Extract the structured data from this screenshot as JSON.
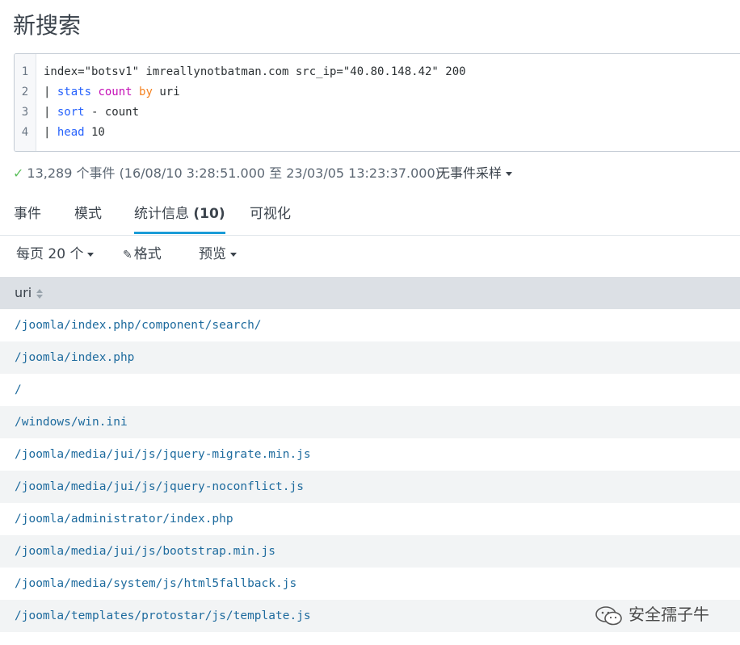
{
  "page_title": "新搜索",
  "query": {
    "line_numbers": [
      "1",
      "2",
      "3",
      "4"
    ],
    "line1": "index=\"botsv1\" imreallynotbatman.com src_ip=\"40.80.148.42\" 200",
    "line2": {
      "pipe": "| ",
      "cmd": "stats",
      "func": "count",
      "by": "by",
      "field": "uri"
    },
    "line3": {
      "pipe": "| ",
      "cmd": "sort",
      "rest": " - count"
    },
    "line4": {
      "pipe": "| ",
      "cmd": "head",
      "rest": " 10"
    }
  },
  "status": {
    "check_icon": "checkmark-icon",
    "text": "13,289 个事件 (16/08/10 3:28:51.000 至 23/03/05 13:23:37.000)",
    "sampling": "无事件采样"
  },
  "tabs": [
    {
      "label": "事件"
    },
    {
      "label": "模式"
    },
    {
      "label": "统计信息",
      "count": "(10)"
    },
    {
      "label": "可视化"
    }
  ],
  "toolbar": {
    "per_page": "每页 20 个",
    "format": "格式",
    "preview": "预览"
  },
  "table": {
    "column": "uri",
    "rows": [
      "/joomla/index.php/component/search/",
      "/joomla/index.php",
      "/",
      "/windows/win.ini",
      "/joomla/media/jui/js/jquery-migrate.min.js",
      "/joomla/media/jui/js/jquery-noconflict.js",
      "/joomla/administrator/index.php",
      "/joomla/media/jui/js/bootstrap.min.js",
      "/joomla/media/system/js/html5fallback.js",
      "/joomla/templates/protostar/js/template.js"
    ]
  },
  "watermark": "安全孺子牛",
  "colors": {
    "accent": "#1a9cd7",
    "link": "#1e6b9e",
    "header_bg": "#dce0e5",
    "row_alt": "#f2f4f5"
  }
}
